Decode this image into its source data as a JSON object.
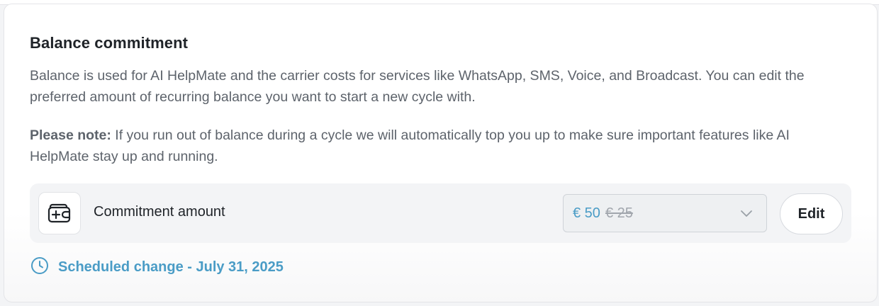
{
  "section": {
    "title": "Balance commitment",
    "description": "Balance is used for AI HelpMate and the carrier costs for services like WhatsApp, SMS, Voice, and Broadcast. You can edit the preferred amount of recurring balance you want to start a new cycle with.",
    "note_label": "Please note:",
    "note_text": " If you run out of balance during a cycle we will automatically top you up to make sure important features like AI HelpMate stay up and running."
  },
  "commitment": {
    "icon": "wallet-plus-icon",
    "label": "Commitment amount",
    "new_amount": "€ 50",
    "old_amount": "€ 25",
    "edit_label": "Edit"
  },
  "schedule": {
    "icon": "clock-icon",
    "text": "Scheduled change - July 31, 2025"
  },
  "colors": {
    "accent": "#4a9cc6",
    "text_primary": "#1f2328",
    "text_secondary": "#5d636b",
    "row_background": "#f3f4f6"
  }
}
